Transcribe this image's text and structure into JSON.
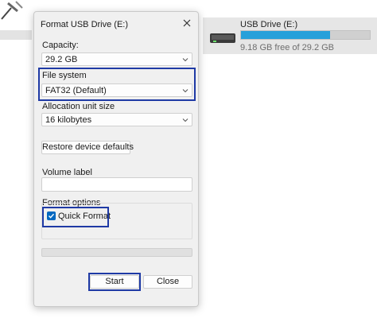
{
  "drive_tile": {
    "name": "USB Drive (E:)",
    "free_text": "9.18 GB free of 29.2 GB",
    "used_fraction": 0.69,
    "bar_color": "#26a0da"
  },
  "dialog": {
    "title": "Format USB Drive (E:)",
    "capacity_label": "Capacity:",
    "capacity_value": "29.2 GB",
    "filesystem_label": "File system",
    "filesystem_value": "FAT32 (Default)",
    "allocation_label": "Allocation unit size",
    "allocation_value": "16 kilobytes",
    "restore_button": "Restore device defaults",
    "volume_label": "Volume label",
    "volume_value": "",
    "format_options_label": "Format options",
    "quick_format_label": "Quick Format",
    "quick_format_checked": true,
    "start_button": "Start",
    "close_button": "Close"
  },
  "colors": {
    "highlight": "#1f3aa5",
    "checkbox": "#0067c0"
  }
}
